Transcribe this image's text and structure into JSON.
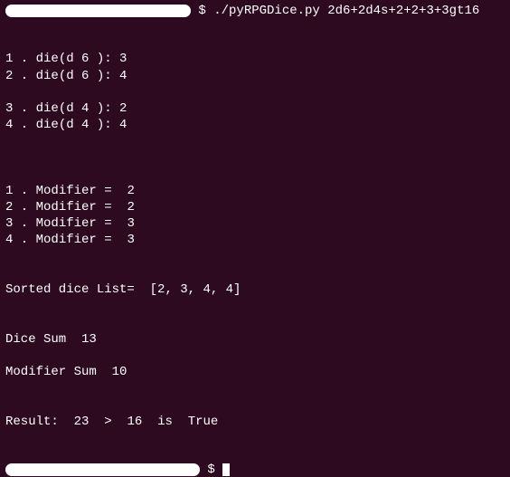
{
  "prompt": {
    "symbol": "$",
    "command": "./pyRPGDice.py 2d6+2d4s+2+2+3+3gt16"
  },
  "die_rolls": [
    {
      "n": "1",
      "sides": "6",
      "value": "3"
    },
    {
      "n": "2",
      "sides": "6",
      "value": "4"
    },
    {
      "n": "3",
      "sides": "4",
      "value": "2"
    },
    {
      "n": "4",
      "sides": "4",
      "value": "4"
    }
  ],
  "modifiers": [
    {
      "n": "1",
      "value": "2"
    },
    {
      "n": "2",
      "value": "2"
    },
    {
      "n": "3",
      "value": "3"
    },
    {
      "n": "4",
      "value": "3"
    }
  ],
  "sorted_label": "Sorted dice List=",
  "sorted_list": "[2, 3, 4, 4]",
  "dice_sum_label": "Dice Sum",
  "dice_sum": "13",
  "mod_sum_label": "Modifier Sum",
  "mod_sum": "10",
  "result_label": "Result:",
  "result_total": "23",
  "result_op": ">",
  "result_threshold": "16",
  "result_is": "is",
  "result_bool": "True"
}
